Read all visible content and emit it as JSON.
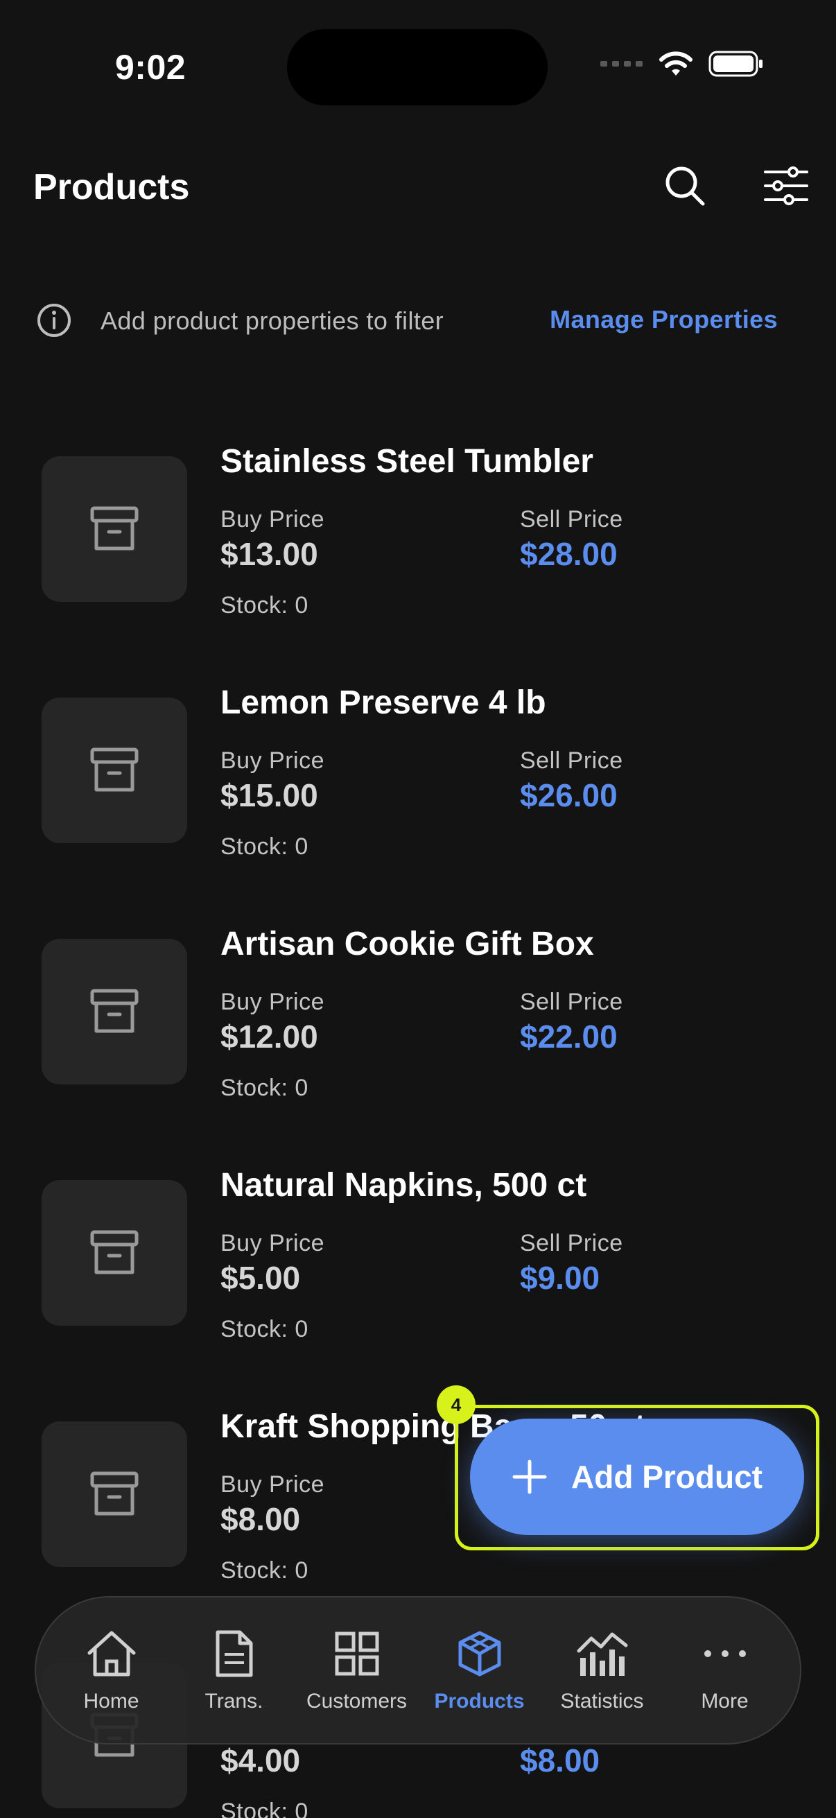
{
  "status": {
    "time": "9:02"
  },
  "header": {
    "title": "Products"
  },
  "info": {
    "text": "Add product properties to filter",
    "link": "Manage Properties"
  },
  "labels": {
    "buy": "Buy Price",
    "sell": "Sell Price"
  },
  "products": [
    {
      "name": "Stainless Steel Tumbler",
      "buy": "$13.00",
      "sell": "$28.00",
      "stock": "Stock: 0"
    },
    {
      "name": "Lemon Preserve 4 lb",
      "buy": "$15.00",
      "sell": "$26.00",
      "stock": "Stock: 0"
    },
    {
      "name": "Artisan Cookie Gift Box",
      "buy": "$12.00",
      "sell": "$22.00",
      "stock": "Stock: 0"
    },
    {
      "name": "Natural Napkins, 500 ct",
      "buy": "$5.00",
      "sell": "$9.00",
      "stock": "Stock: 0"
    },
    {
      "name": "Kraft Shopping Bags, 50 ct",
      "buy": "$8.00",
      "sell": "",
      "stock": "Stock: 0"
    },
    {
      "name": "",
      "buy": "$4.00",
      "sell": "$8.00",
      "stock": "Stock: 0"
    }
  ],
  "fab": {
    "label": "Add Product",
    "badge": "4"
  },
  "nav": [
    {
      "label": "Home",
      "icon": "home-icon"
    },
    {
      "label": "Trans.",
      "icon": "document-icon"
    },
    {
      "label": "Customers",
      "icon": "grid-icon"
    },
    {
      "label": "Products",
      "icon": "cube-icon",
      "active": true
    },
    {
      "label": "Statistics",
      "icon": "chart-icon"
    },
    {
      "label": "More",
      "icon": "more-icon"
    }
  ],
  "colors": {
    "accent": "#5b8def",
    "highlight": "#d6f21a",
    "background": "#131313"
  }
}
